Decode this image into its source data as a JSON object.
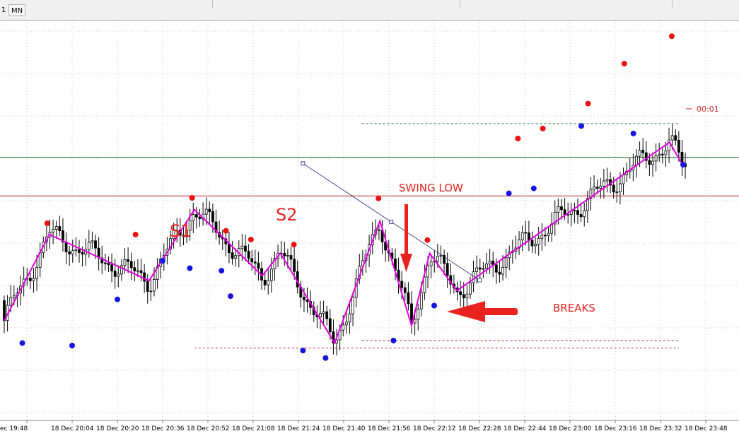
{
  "toolbar": {
    "timeframe_partial": "1",
    "timeframe_mn": "MN"
  },
  "colors": {
    "zigzag": "#e000e0",
    "swing_high": "#ee1111",
    "swing_low": "#1515e0",
    "annotation": "#e8231f",
    "price_line": "#2e7d32",
    "resistance": "#c62828",
    "grid": "#c8c8c8",
    "candle_up": "#000000",
    "candle_down": "#000000"
  },
  "chart_data": {
    "type": "candlestick",
    "x_tick_labels": [
      "18 Dec 19:48",
      "18 Dec 20:04",
      "18 Dec 20:20",
      "18 Dec 20:36",
      "18 Dec 20:52",
      "18 Dec 21:08",
      "18 Dec 21:24",
      "18 Dec 21:40",
      "18 Dec 21:56",
      "18 Dec 22:12",
      "18 Dec 22:28",
      "18 Dec 22:44",
      "18 Dec 23:00",
      "18 Dec 23:16",
      "18 Dec 23:32",
      "18 Dec 23:48"
    ],
    "x_tick_first_display": "ec 19:48",
    "y_scale_note": "no price labels visible",
    "zigzag": [
      {
        "t": 0,
        "p": 0.27
      },
      {
        "t": 1,
        "p": 0.615
      },
      {
        "t": 3.2,
        "p": 0.43
      },
      {
        "t": 4.2,
        "p": 0.715
      },
      {
        "t": 5.7,
        "p": 0.45
      },
      {
        "t": 6.1,
        "p": 0.54
      },
      {
        "t": 7.3,
        "p": 0.18
      },
      {
        "t": 8.3,
        "p": 0.67
      },
      {
        "t": 9.0,
        "p": 0.25
      },
      {
        "t": 9.4,
        "p": 0.54
      },
      {
        "t": 10.0,
        "p": 0.39
      },
      {
        "t": 14.7,
        "p": 0.985
      },
      {
        "t": 15.0,
        "p": 0.89
      }
    ],
    "swing_highs": [
      {
        "t": 0.95,
        "p": 0.66
      },
      {
        "t": 2.9,
        "p": 0.615
      },
      {
        "t": 4.15,
        "p": 0.762
      },
      {
        "t": 4.9,
        "p": 0.63
      },
      {
        "t": 5.45,
        "p": 0.595
      },
      {
        "t": 6.4,
        "p": 0.575
      },
      {
        "t": 8.27,
        "p": 0.76
      },
      {
        "t": 9.35,
        "p": 0.593
      },
      {
        "t": 11.35,
        "p": 1.0
      },
      {
        "t": 11.9,
        "p": 1.04
      },
      {
        "t": 12.9,
        "p": 1.14
      },
      {
        "t": 13.7,
        "p": 1.3
      },
      {
        "t": 14.75,
        "p": 1.41
      }
    ],
    "swing_lows": [
      {
        "t": 0.4,
        "p": 0.18
      },
      {
        "t": 1.5,
        "p": 0.17
      },
      {
        "t": 2.5,
        "p": 0.355
      },
      {
        "t": 3.5,
        "p": 0.51
      },
      {
        "t": 4.1,
        "p": 0.48
      },
      {
        "t": 4.8,
        "p": 0.47
      },
      {
        "t": 5.0,
        "p": 0.368
      },
      {
        "t": 6.6,
        "p": 0.15
      },
      {
        "t": 7.1,
        "p": 0.12
      },
      {
        "t": 8.6,
        "p": 0.19
      },
      {
        "t": 9.5,
        "p": 0.33
      },
      {
        "t": 11.15,
        "p": 0.78
      },
      {
        "t": 11.7,
        "p": 0.8
      },
      {
        "t": 12.75,
        "p": 1.05
      },
      {
        "t": 13.9,
        "p": 1.02
      },
      {
        "t": 15.0,
        "p": 0.895
      }
    ],
    "levels": [
      {
        "name": "current-price-line",
        "p": 0.925,
        "style": "solid",
        "color_key": "price_line"
      },
      {
        "name": "resistance-line",
        "p": 0.77,
        "style": "solid",
        "color_key": "resistance"
      },
      {
        "name": "green-dotted-level",
        "p": 1.06,
        "style": "dotted",
        "color_key": "price_line",
        "from_t": 7.9
      },
      {
        "name": "red-dotted-level-1",
        "p": 0.19,
        "style": "dotted",
        "color_key": "resistance",
        "from_t": 7.9
      },
      {
        "name": "red-dotted-level-2",
        "p": 0.16,
        "style": "dotted",
        "color_key": "resistance",
        "from_t": 4.2
      }
    ],
    "trendline": {
      "from": {
        "t": 6.6,
        "p": 0.9
      },
      "to": {
        "t": 10.5,
        "p": 0.432
      }
    },
    "price_label": "00:01",
    "annotations": {
      "s1": "S1",
      "s2": "S2",
      "swing_low": "SWING LOW",
      "breaks": "BREAKS"
    }
  }
}
